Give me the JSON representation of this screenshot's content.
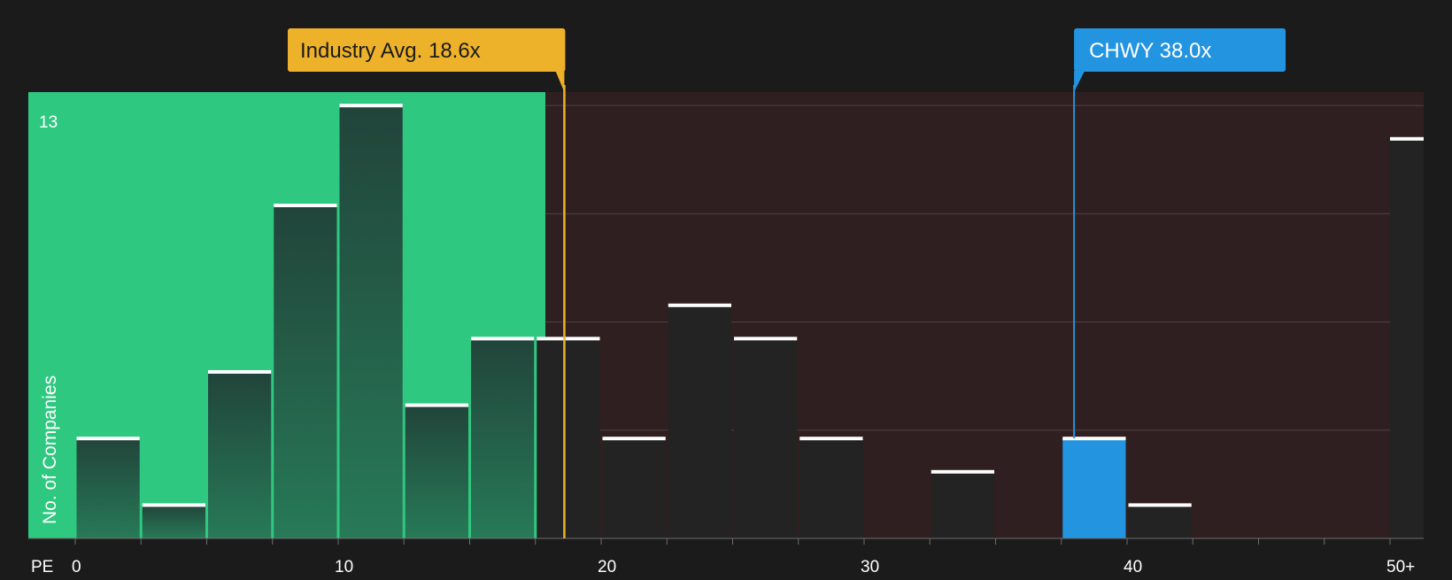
{
  "chart_data": {
    "type": "bar",
    "xlabel": "PE",
    "ylabel": "No. of Companies",
    "y_tick_label": "13",
    "ylim": [
      0,
      13
    ],
    "x_ticks": [
      {
        "value": 0,
        "label": "0"
      },
      {
        "value": 10,
        "label": "10"
      },
      {
        "value": 20,
        "label": "20"
      },
      {
        "value": 30,
        "label": "30"
      },
      {
        "value": 40,
        "label": "40"
      },
      {
        "value": 50,
        "label": "50+"
      }
    ],
    "bin_width": 2.5,
    "bins": [
      {
        "start": 0,
        "count": 3
      },
      {
        "start": 2.5,
        "count": 1
      },
      {
        "start": 5,
        "count": 5
      },
      {
        "start": 7.5,
        "count": 10
      },
      {
        "start": 10,
        "count": 13
      },
      {
        "start": 12.5,
        "count": 4
      },
      {
        "start": 15,
        "count": 6
      },
      {
        "start": 17.5,
        "count": 6
      },
      {
        "start": 20,
        "count": 3
      },
      {
        "start": 22.5,
        "count": 7
      },
      {
        "start": 25,
        "count": 6
      },
      {
        "start": 27.5,
        "count": 3
      },
      {
        "start": 32.5,
        "count": 2
      },
      {
        "start": 37.5,
        "count": 3,
        "highlight": true
      },
      {
        "start": 40,
        "count": 1
      },
      {
        "start": 50,
        "count": 12
      }
    ],
    "industry_avg": {
      "value": 18.6,
      "label": "Industry Avg. 18.6x"
    },
    "company": {
      "ticker": "CHWY",
      "value": 38.0,
      "label": "CHWY 38.0x"
    },
    "colors": {
      "background": "#1b1b1b",
      "below_avg_region": "#2fc880",
      "above_avg_region": "#2f1f20",
      "bar_dark": "#232323",
      "bar_green_top": "#21443a",
      "bar_green_bottom": "#277a58",
      "highlight_bar": "#2394e0",
      "industry_marker": "#edb22a",
      "company_marker": "#2394e0",
      "bar_cap": "#ffffff",
      "gridline": "#4a4444",
      "axis_text": "#ffffff"
    }
  }
}
